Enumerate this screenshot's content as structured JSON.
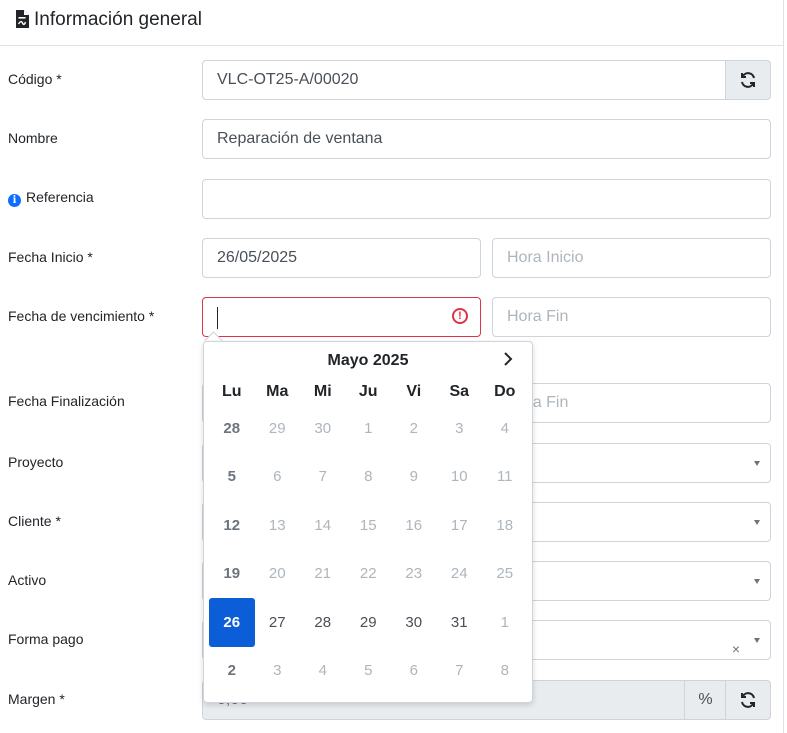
{
  "header": {
    "title": "Información general",
    "icon": "document-icon"
  },
  "fields": {
    "codigo": {
      "label": "Código *",
      "value": "VLC-OT25-A/00020",
      "action_icon": "refresh-icon"
    },
    "nombre": {
      "label": "Nombre",
      "value": "Reparación de ventana"
    },
    "referencia": {
      "label": "Referencia",
      "info_icon": "info-icon",
      "value": ""
    },
    "fecha_inicio": {
      "label": "Fecha Inicio *",
      "value": "26/05/2025",
      "hora_placeholder": "Hora Inicio"
    },
    "fecha_vencimiento": {
      "label": "Fecha de vencimiento *",
      "value": "",
      "error_icon": "error-icon",
      "hora_placeholder": "Hora Fin"
    },
    "fecha_finalizacion": {
      "label": "Fecha Finalización",
      "hora_placeholder": "Hora Fin"
    },
    "proyecto": {
      "label": "Proyecto"
    },
    "cliente": {
      "label": "Cliente *"
    },
    "activo": {
      "label": "Activo"
    },
    "forma_pago": {
      "label": "Forma pago",
      "clear": "×"
    },
    "margen": {
      "label": "Margen *",
      "value": "0,00",
      "unit": "%",
      "action_icon": "refresh-icon"
    }
  },
  "datepicker": {
    "month": "Mayo 2025",
    "next": "›",
    "weekdays": [
      "Lu",
      "Ma",
      "Mi",
      "Ju",
      "Vi",
      "Sa",
      "Do"
    ],
    "weeks": [
      [
        "28",
        "29",
        "30",
        "1",
        "2",
        "3",
        "4"
      ],
      [
        "5",
        "6",
        "7",
        "8",
        "9",
        "10",
        "11"
      ],
      [
        "12",
        "13",
        "14",
        "15",
        "16",
        "17",
        "18"
      ],
      [
        "19",
        "20",
        "21",
        "22",
        "23",
        "24",
        "25"
      ],
      [
        "26",
        "27",
        "28",
        "29",
        "30",
        "31",
        "1"
      ],
      [
        "2",
        "3",
        "4",
        "5",
        "6",
        "7",
        "8"
      ]
    ],
    "selected": "26"
  }
}
